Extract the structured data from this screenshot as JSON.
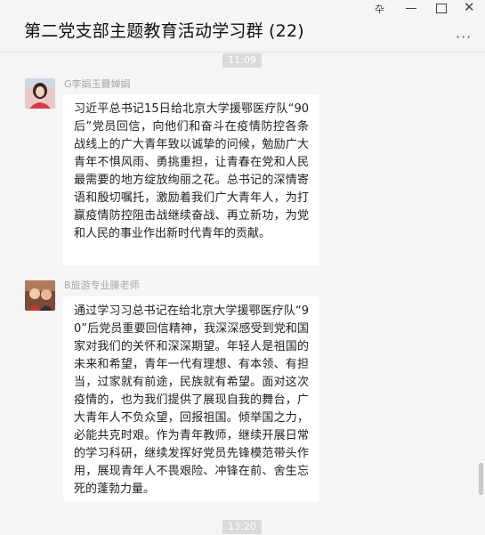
{
  "window": {
    "title": "第二党支部主题教育活动学习群 (22)",
    "pin_glyph": "卆",
    "close_glyph": "✕",
    "more_glyph": "···"
  },
  "messages": [
    {
      "time": "11:09",
      "sender": "G李娟玉爨婵娟",
      "text": "习近平总书记15日给北京大学援鄂医疗队“90后”党员回信，向他们和奋斗在疫情防控各条战线上的广大青年致以诚挚的问候，勉励广大青年不惧风雨、勇挑重担，让青春在党和人民最需要的地方绽放绚丽之花。总书记的深情寄语和殷切嘱托，激励着我们广大青年人，为打赢疫情防控阻击战继续奋战、再立新功，为党和人民的事业作出新时代青年的贡献。"
    },
    {
      "sender": "B旅游专业滕老师",
      "text": "通过学习习总书记在给北京大学援鄂医疗队“90”后党员重要回信精神，我深深感受到党和国家对我们的关怀和深深期望。年轻人是祖国的未来和希望，青年一代有理想、有本领、有担当，过家就有前途，民族就有希望。面对这次疫情的，也为我们提供了展现自我的舞台，广大青年人不负众望，回报祖国。倾举国之力，必能共克时艰。作为青年教师，继续开展日常的学习科研，继续发挥好党员先锋模范带头作用，展现青年人不畏艰险、冲锋在前、舍生忘死的蓬勃力量。"
    }
  ],
  "next_time": "13:20"
}
